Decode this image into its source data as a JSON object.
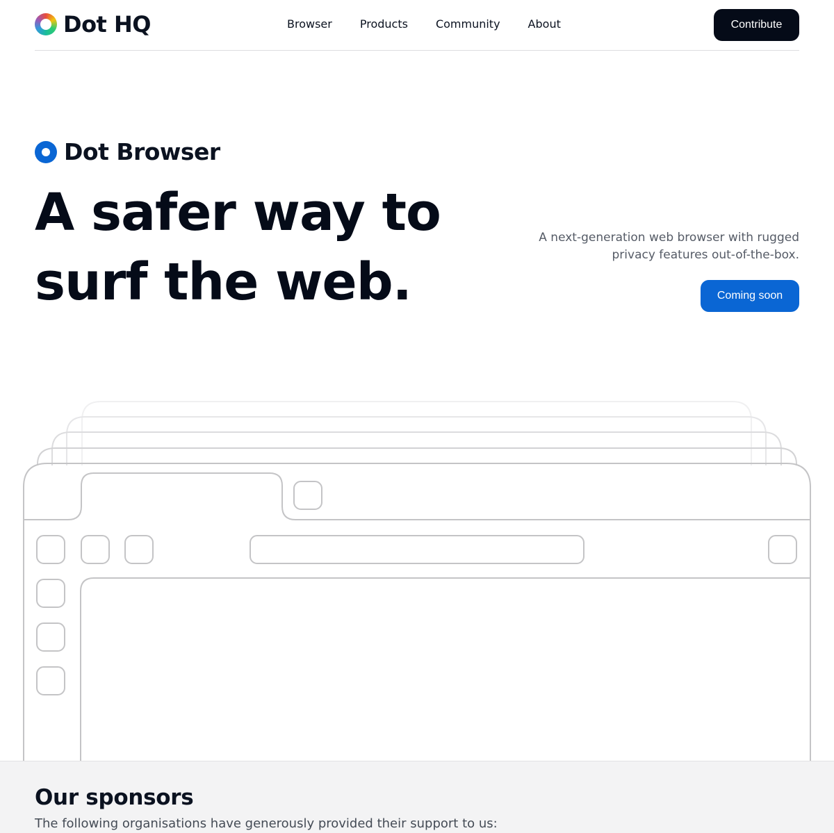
{
  "header": {
    "logo_text": "Dot HQ",
    "nav": [
      "Browser",
      "Products",
      "Community",
      "About"
    ],
    "contribute_label": "Contribute"
  },
  "hero": {
    "product_name": "Dot Browser",
    "headline_line1": "A safer way to",
    "headline_line2": "surf the web.",
    "tagline": "A next-generation web browser with rugged privacy features out-of-the-box.",
    "cta_label": "Coming soon"
  },
  "sponsors": {
    "title": "Our sponsors",
    "subtitle": "The following organisations have generously provided their support to us:"
  },
  "colors": {
    "accent": "#0a66d4",
    "dark": "#050b18",
    "outline": "#c4c4c6"
  },
  "icons": [
    "dot-hq-logo-icon",
    "dot-browser-logo-icon"
  ]
}
